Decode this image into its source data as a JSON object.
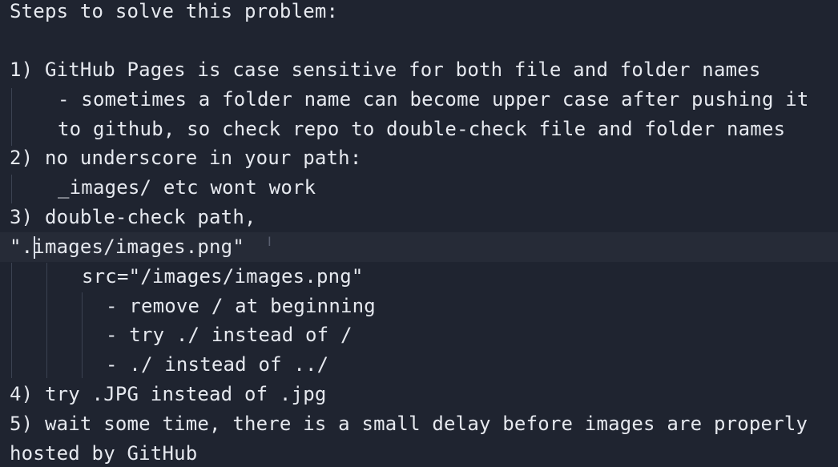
{
  "editor": {
    "lines": [
      "Steps to solve this problem:",
      "",
      "1) GitHub Pages is case sensitive for both file and folder names",
      "- sometimes a folder name can become upper case after pushing it",
      "to github, so check repo to double-check file and folder names",
      "2) no underscore in your path:",
      "_images/ etc wont work",
      "3) double-check path,",
      "\".images/images.png\"",
      "src=\"/images/images.png\"",
      "- remove / at beginning",
      "- try ./ instead of /",
      "- ./ instead of ../",
      "4) try .JPG instead of .jpg",
      "5) wait some time, there is a small delay before images are properly",
      "hosted by GitHub"
    ]
  }
}
